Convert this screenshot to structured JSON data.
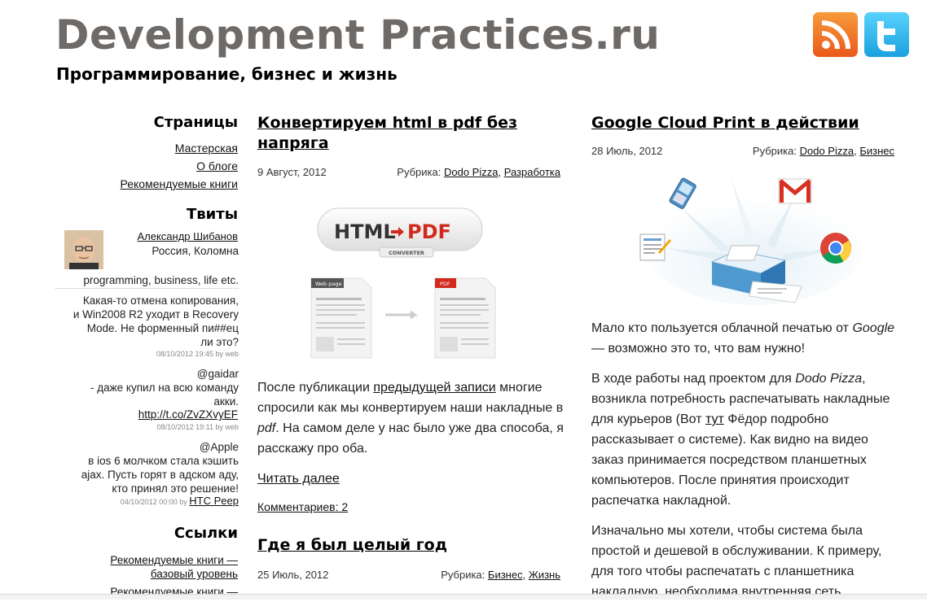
{
  "header": {
    "title": "Development Practices.ru",
    "subtitle": "Программирование, бизнес и жизнь"
  },
  "sidebar": {
    "pages_heading": "Страницы",
    "pages": [
      "Мастерская",
      "О блоге",
      "Рекомендуемые книги"
    ],
    "tweets_heading": "Твиты",
    "profile": {
      "name": "Александр Шибанов",
      "location": "Россия, Коломна",
      "bio": "programming, business, life etc."
    },
    "tweets": [
      {
        "lines": [
          "Какая-то отмена копирования,",
          "и Win2008 R2 уходит в Recovery",
          "Mode. Не форменный пи##ец",
          "ли это?"
        ],
        "meta": "08/10/2012 19:45 by web"
      },
      {
        "lines": [
          "@gaidar",
          "- даже купил на всю команду",
          "акки."
        ],
        "link": "http://t.co/ZvZXvyEF",
        "meta": "08/10/2012 19:11 by web"
      },
      {
        "lines": [
          "@Apple",
          "в ios 6 молчком стала кэшить",
          "ajax. Пусть горят в адском аду,",
          "кто принял это решение!"
        ],
        "meta": "04/10/2012 00:00 by",
        "meta_link": "HTC Peep"
      }
    ],
    "links_heading": "Ссылки",
    "links": [
      [
        "Рекомендуемые книги —",
        "базовый уровень"
      ],
      [
        "Рекомендуемые книги —"
      ]
    ]
  },
  "posts": [
    {
      "title_lines": [
        "Конвертируем html в pdf без",
        "напряга"
      ],
      "date": "9 Август, 2012",
      "rubric_label": "Рубрика:",
      "categories": [
        "Dodo Pizza",
        "Разработка"
      ],
      "image": {
        "badge_left": "HTML",
        "badge_right": "PDF",
        "badge_sub": "CONVERTER",
        "doc_left": "Web page",
        "doc_right": "PDF"
      },
      "para": {
        "t1": "После публикации ",
        "link": "предыдущей записи",
        "t2": " многие спросили как мы конвертируем наши накладные в ",
        "em": "pdf",
        "t3": ". На самом деле у нас было уже два способа, я расскажу про оба."
      },
      "read_more": "Читать далее",
      "comments": "Комментариев: 2"
    },
    {
      "title_lines": [
        "Где я был целый год"
      ],
      "date": "25 Июль, 2012",
      "rubric_label": "Рубрика:",
      "categories": [
        "Бизнес",
        "Жизнь"
      ]
    },
    {
      "title_lines": [
        "Google Cloud Print в действии"
      ],
      "date": "28 Июль, 2012",
      "rubric_label": "Рубрика:",
      "categories": [
        "Dodo Pizza",
        "Бизнес"
      ],
      "p1": {
        "t1": "Мало кто пользуется облачной печатью от ",
        "em": "Google",
        "t2": " — возможно это то, что вам нужно!"
      },
      "p2": {
        "t1": "В ходе работы над проектом для ",
        "em": "Dodo Pizza",
        "t2": ", возникла потребность распечатывать накладные для курьеров (Вот ",
        "link": "тут",
        "t3": " Фёдор подробно рассказывает о системе). Как видно на видео заказ принимается посредством планшетных компьютеров. После принятия происходит распечатка накладной."
      },
      "p3": "Изначально мы хотели, чтобы система была простой и дешевой в обслуживании. К примеру, для того чтобы распечатать с планшетника накладную, необходима внутренняя сеть"
    }
  ],
  "icons": {
    "rss": "rss-icon",
    "twitter": "twitter-icon",
    "gmail": "gmail-icon",
    "chrome": "chrome-icon",
    "printer": "printer-icon",
    "phone": "phone-icon",
    "document": "document-icon"
  },
  "colors": {
    "title_gray": "#6e6a67",
    "rss_orange": "#e9591a",
    "twitter_blue": "#1aa1df",
    "pdf_red": "#d12a1c"
  }
}
